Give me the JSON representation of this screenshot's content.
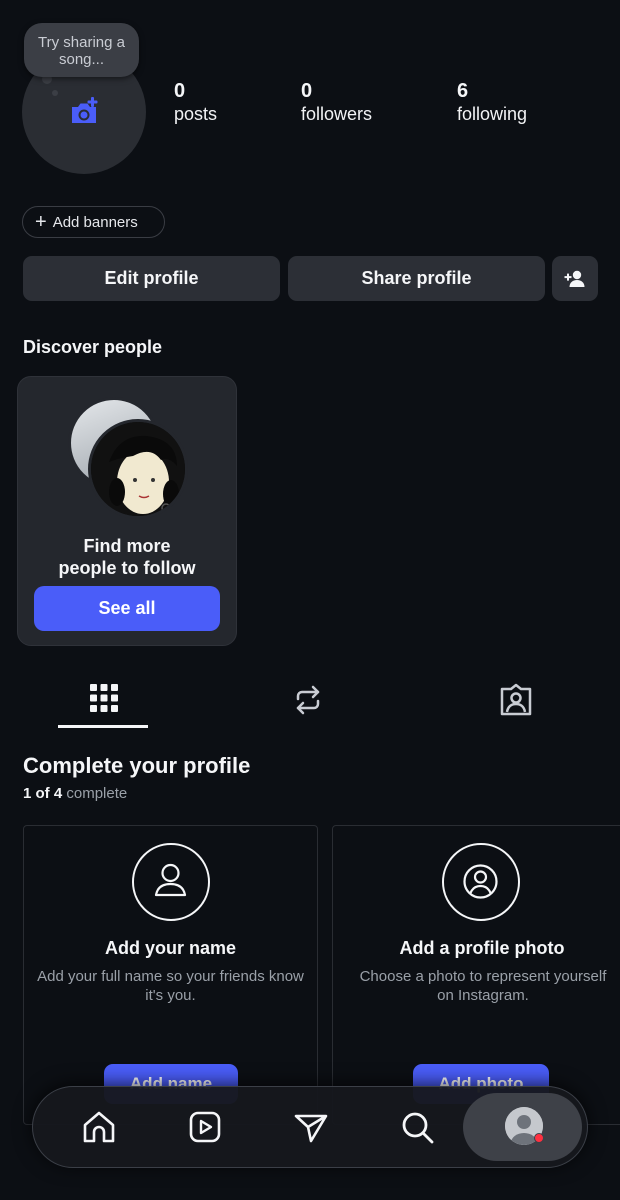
{
  "profile": {
    "note": "Try sharing a song...",
    "stats": [
      {
        "count": "0",
        "label": "posts"
      },
      {
        "count": "0",
        "label": "followers"
      },
      {
        "count": "6",
        "label": "following"
      }
    ],
    "add_banners_label": "Add banners",
    "edit_profile_label": "Edit profile",
    "share_profile_label": "Share profile"
  },
  "discover": {
    "title": "Discover people",
    "card_text": "Find more people to follow",
    "see_all_label": "See all"
  },
  "tabs": [
    {
      "icon": "grid-icon",
      "active": true
    },
    {
      "icon": "reposts-icon",
      "active": false
    },
    {
      "icon": "tagged-icon",
      "active": false
    }
  ],
  "complete_profile": {
    "title": "Complete your profile",
    "progress": "1 of 4",
    "progress_suffix": "complete",
    "tasks": [
      {
        "title": "Add your name",
        "description": "Add your full name so your friends know it's you.",
        "button": "Add name",
        "icon": "person-icon"
      },
      {
        "title": "Add a profile photo",
        "description": "Choose a photo to represent yourself on Instagram.",
        "button": "Add photo",
        "icon": "profile-photo-icon"
      }
    ]
  },
  "bottom_nav": {
    "items": [
      "home-icon",
      "reels-icon",
      "messages-icon",
      "search-icon",
      "profile-avatar"
    ],
    "active": "profile-avatar",
    "notification_dot_color": "#ff3040"
  },
  "colors": {
    "background": "#0c0f14",
    "accent": "#4a5df9",
    "button_gray": "#2c2f36"
  }
}
